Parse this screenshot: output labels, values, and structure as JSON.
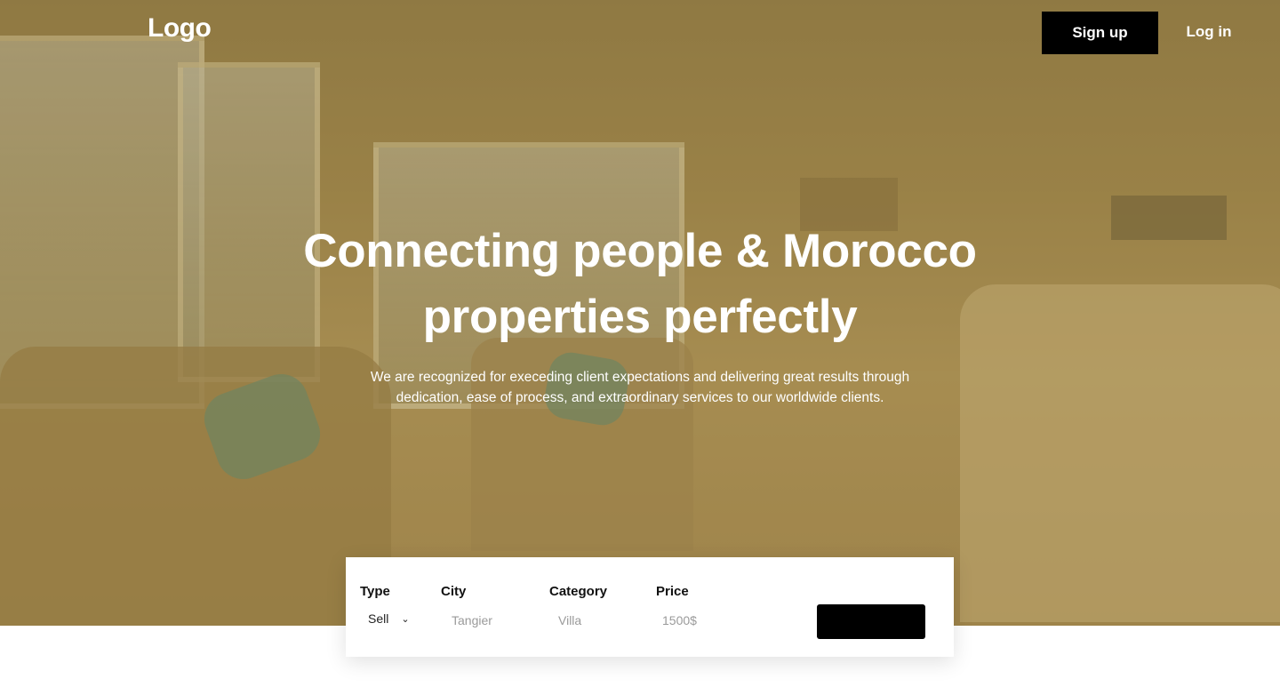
{
  "header": {
    "logo": "Logo",
    "signup_label": "Sign up",
    "login_label": "Log in"
  },
  "hero": {
    "headline_line1": "Connecting people & Morocco",
    "headline_line2": "properties perfectly",
    "subline_line1": "We are recognized for execeding client expectations and delivering great results through",
    "subline_line2": "dedication, ease of process, and extraordinary services to our worldwide clients."
  },
  "search": {
    "type": {
      "label": "Type",
      "value": "Sell"
    },
    "city": {
      "label": "City",
      "placeholder": "Tangier"
    },
    "category": {
      "label": "Category",
      "placeholder": "Villa"
    },
    "price": {
      "label": "Price",
      "placeholder": "1500$"
    },
    "button_label": ""
  },
  "colors": {
    "button_bg": "#000000",
    "hero_tint": "#9c8650",
    "text_on_hero": "#ffffff"
  },
  "icons": {
    "type_dropdown": "chevron-down-icon"
  }
}
